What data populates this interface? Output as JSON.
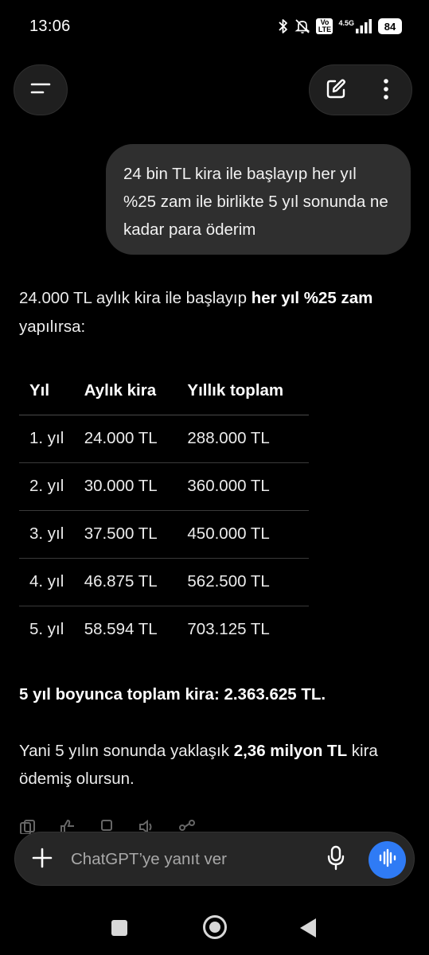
{
  "status_bar": {
    "time": "13:06",
    "volte": "Vo\nLTE",
    "network_type": "4.5G",
    "battery": "84"
  },
  "top_bar": {
    "menu_icon": "hamburger-icon",
    "new_chat_icon": "edit-icon",
    "more_icon": "more-vertical-icon"
  },
  "user_message": {
    "text": "24 bin TL kira ile başlayıp her yıl %25 zam ile birlikte 5 yıl sonunda ne kadar para öderim"
  },
  "assistant": {
    "intro_prefix": "24.000 TL aylık kira ile başlayıp ",
    "intro_bold": "her yıl %25 zam",
    "intro_suffix": " yapılırsa:",
    "table": {
      "headers": [
        "Yıl",
        "Aylık kira",
        "Yıllık toplam"
      ],
      "rows": [
        [
          "1. yıl",
          "24.000 TL",
          "288.000 TL"
        ],
        [
          "2. yıl",
          "30.000 TL",
          "360.000 TL"
        ],
        [
          "3. yıl",
          "37.500 TL",
          "450.000 TL"
        ],
        [
          "4. yıl",
          "46.875 TL",
          "562.500 TL"
        ],
        [
          "5. yıl",
          "58.594 TL",
          "703.125 TL"
        ]
      ]
    },
    "total_line": "5 yıl boyunca toplam kira: 2.363.625 TL.",
    "summary_prefix": "Yani 5 yılın sonunda yaklaşık ",
    "summary_bold": "2,36 milyon TL",
    "summary_suffix": " kira ödemiş olursun."
  },
  "composer": {
    "placeholder": "ChatGPT’ye yanıt ver",
    "plus_icon": "plus-icon",
    "mic_icon": "microphone-icon",
    "voice_icon": "voice-mode-icon",
    "accent": "#2f7bf5"
  },
  "nav_bar": {
    "recents_icon": "recents-icon",
    "home_icon": "home-icon",
    "back_icon": "back-icon"
  }
}
